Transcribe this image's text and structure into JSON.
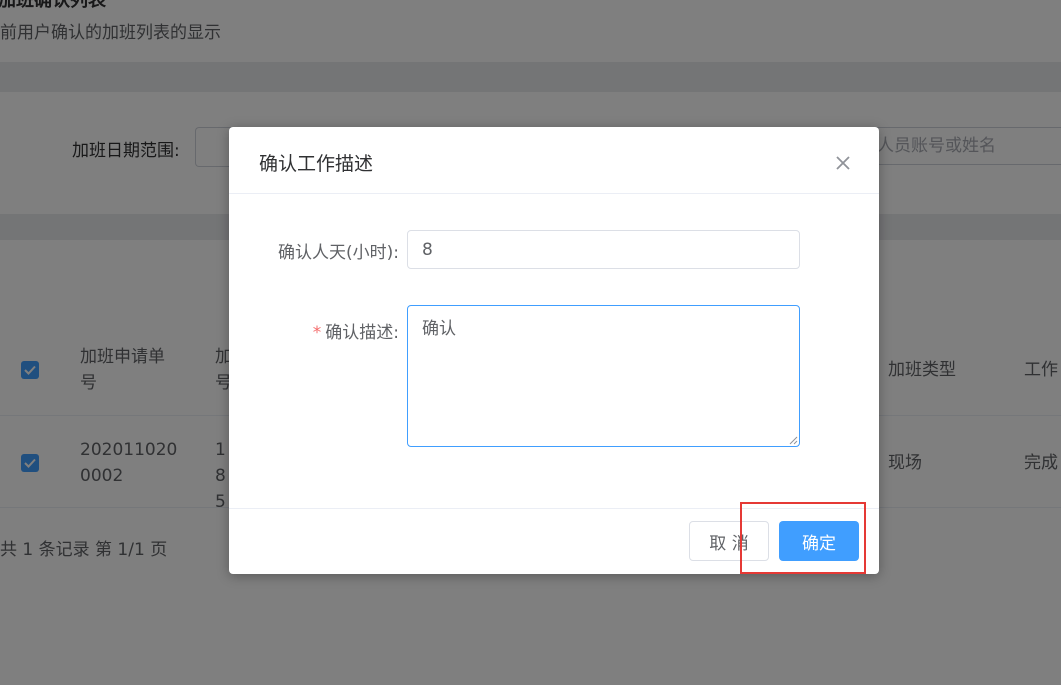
{
  "page": {
    "title": "加班确认列表",
    "subtitle": "前用户确认的加班列表的显示"
  },
  "filters": {
    "date_range_label": "加班日期范围:",
    "search_placeholder": "人员账号或姓名"
  },
  "table": {
    "headers": {
      "request_no": "加班申请单号",
      "col2": "加号",
      "overtime_type": "加班类型",
      "work": "工作"
    },
    "rows": [
      {
        "request_no": "2020110200002",
        "col2": "185",
        "overtime_type": "现场",
        "work": "完成"
      }
    ]
  },
  "pagination": {
    "text": "共 1 条记录 第 1/1 页"
  },
  "dialog": {
    "title": "确认工作描述",
    "hours_label": "确认人天(小时):",
    "hours_value": "8",
    "desc_label": "确认描述:",
    "desc_value": "确认",
    "cancel_label": "取 消",
    "confirm_label": "确定"
  },
  "colors": {
    "primary": "#409eff",
    "required": "#f56c6c",
    "highlight": "#e53935"
  },
  "icons": {
    "close": "close-icon",
    "check": "check-icon"
  }
}
